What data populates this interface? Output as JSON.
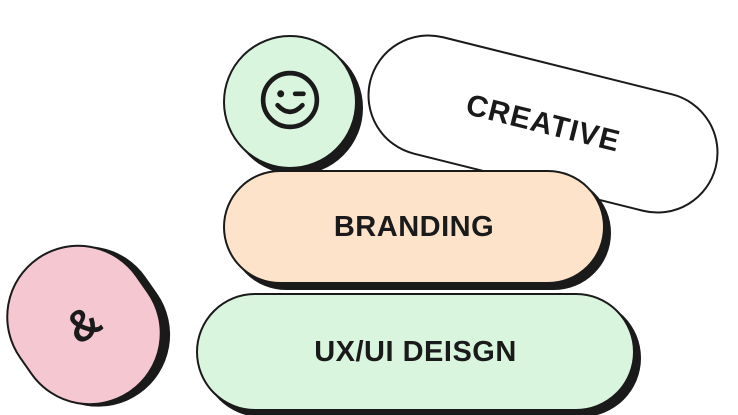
{
  "tags": {
    "creative": "CREATIVE",
    "branding": "BRANDING",
    "uxui": "UX/UI DEISGN",
    "ampersand": "&"
  },
  "icons": {
    "smiley": "winking-smiley-icon"
  },
  "colors": {
    "ink": "#1a1a1a",
    "mint": "#d9f5dd",
    "peach": "#fce3c9",
    "pink": "#f5c7d0",
    "white": "#ffffff"
  }
}
